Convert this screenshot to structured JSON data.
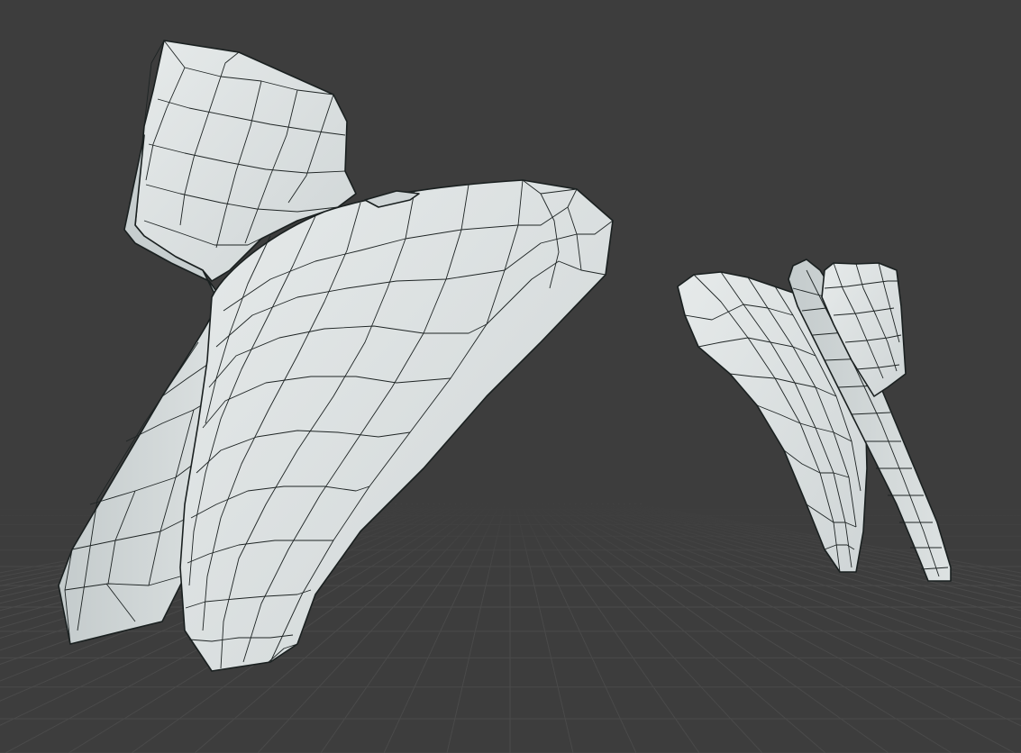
{
  "viewport": {
    "background_color": "#3d3d3d",
    "grid_color": "#4a4a4a",
    "mesh_color": "#dfe3e3",
    "mesh_shadow_color": "#b9c0c1",
    "wire_color": "#1e2424"
  },
  "objects": [
    {
      "name": "large-garment-mesh"
    },
    {
      "name": "small-garment-mesh"
    }
  ]
}
